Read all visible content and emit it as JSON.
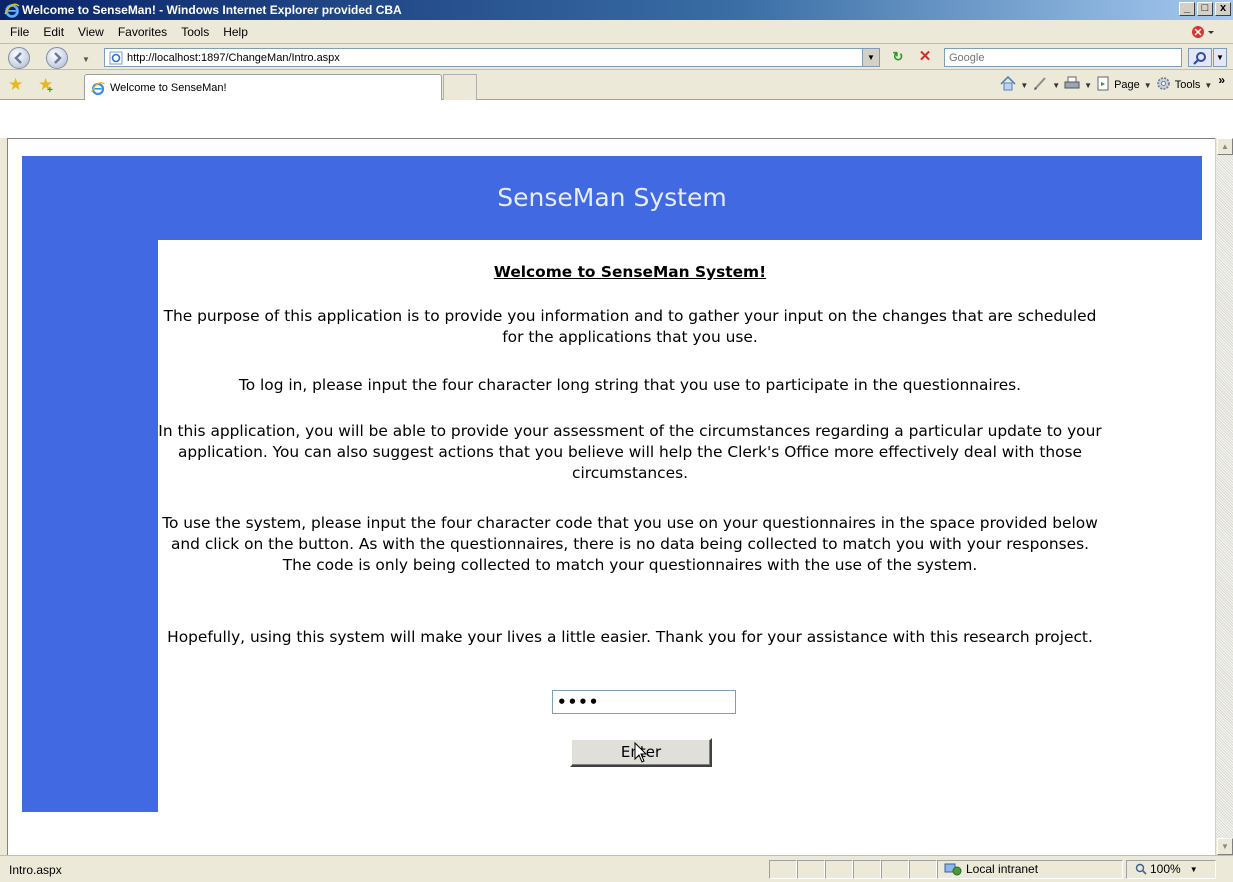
{
  "window": {
    "title": "Welcome to SenseMan! - Windows Internet Explorer provided CBA",
    "buttons": [
      "_",
      "□",
      "x"
    ]
  },
  "menu": {
    "items": [
      "File",
      "Edit",
      "View",
      "Favorites",
      "Tools",
      "Help"
    ]
  },
  "address": {
    "url": "http://localhost:1897/ChangeMan/Intro.aspx",
    "search_placeholder": "Google"
  },
  "tabs": {
    "active_label": "Welcome to SenseMan!"
  },
  "commandbar": {
    "page_label": "Page",
    "tools_label": "Tools",
    "chevron": "»"
  },
  "page": {
    "system_title": "SenseMan System",
    "welcome_heading": "Welcome to SenseMan System!",
    "paragraph1": "The purpose of this application is to provide you information and to gather your input on the changes that are scheduled for the applications that you use.",
    "paragraph2": "To log in, please input the four character long string that you use to participate in the questionnaires.",
    "paragraph3": "In this application, you will be able to provide your assessment of the circumstances regarding a particular update to your application.  You can also suggest actions that you believe will help the Clerk's Office more effectively deal with those circumstances.",
    "paragraph4": "To use the system, please input the four character code that you use on your questionnaires in the space provided below and click on the button.  As with the questionnaires, there is no data being collected to match you with your responses.  The code is only being collected to match your questionnaires with the use of the system.",
    "paragraph5": "Hopefully, using this system will make your lives a little easier.  Thank you for your assistance with this research project.",
    "code_value": "••••",
    "enter_button": "Enter"
  },
  "status": {
    "text": "Intro.aspx",
    "zone": "Local intranet",
    "zoom": "100%"
  },
  "colors": {
    "page_blue": "#4169e1",
    "title_bar": "#0a246a"
  }
}
